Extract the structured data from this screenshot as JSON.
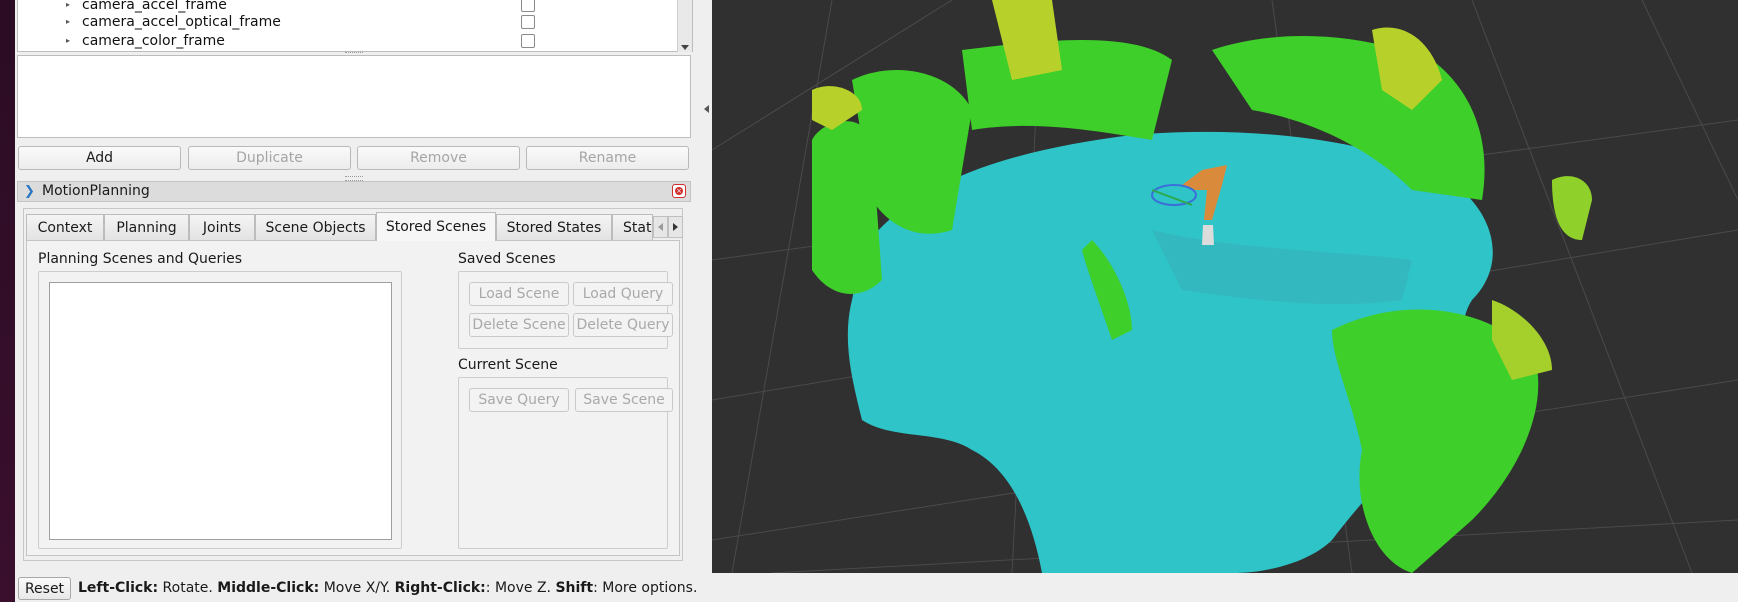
{
  "tf_tree": {
    "rows": [
      {
        "label": "camera_accel_frame"
      },
      {
        "label": "camera_accel_optical_frame"
      },
      {
        "label": "camera_color_frame"
      }
    ]
  },
  "display_buttons": {
    "add": "Add",
    "duplicate": "Duplicate",
    "remove": "Remove",
    "rename": "Rename"
  },
  "motion_planning": {
    "title": "MotionPlanning",
    "tabs": [
      {
        "label": "Context",
        "active": false
      },
      {
        "label": "Planning",
        "active": false
      },
      {
        "label": "Joints",
        "active": false
      },
      {
        "label": "Scene Objects",
        "active": false
      },
      {
        "label": "Stored Scenes",
        "active": true
      },
      {
        "label": "Stored States",
        "active": false
      },
      {
        "label": "Stat",
        "active": false
      }
    ],
    "stored_scenes": {
      "planning_scenes_title": "Planning Scenes and Queries",
      "saved_scenes_title": "Saved Scenes",
      "load_scene": "Load Scene",
      "load_query": "Load Query",
      "delete_scene": "Delete Scene",
      "delete_query": "Delete Query",
      "current_scene_title": "Current Scene",
      "save_query": "Save Query",
      "save_scene": "Save Scene"
    }
  },
  "status_bar": {
    "reset": "Reset",
    "left_click_key": "Left-Click:",
    "left_click_text": " Rotate. ",
    "middle_click_key": "Middle-Click:",
    "middle_click_text": " Move X/Y. ",
    "right_click_key": "Right-Click:",
    "right_click_text": ": Move Z. ",
    "shift_key": "Shift",
    "shift_text": ": More options."
  },
  "colors": {
    "viewport_bg": "#303030",
    "voxel_cyan": "#2fc4c8",
    "voxel_green": "#3fcf2a",
    "voxel_yellow": "#b8d12a",
    "robot_orange": "#d98a3a"
  }
}
